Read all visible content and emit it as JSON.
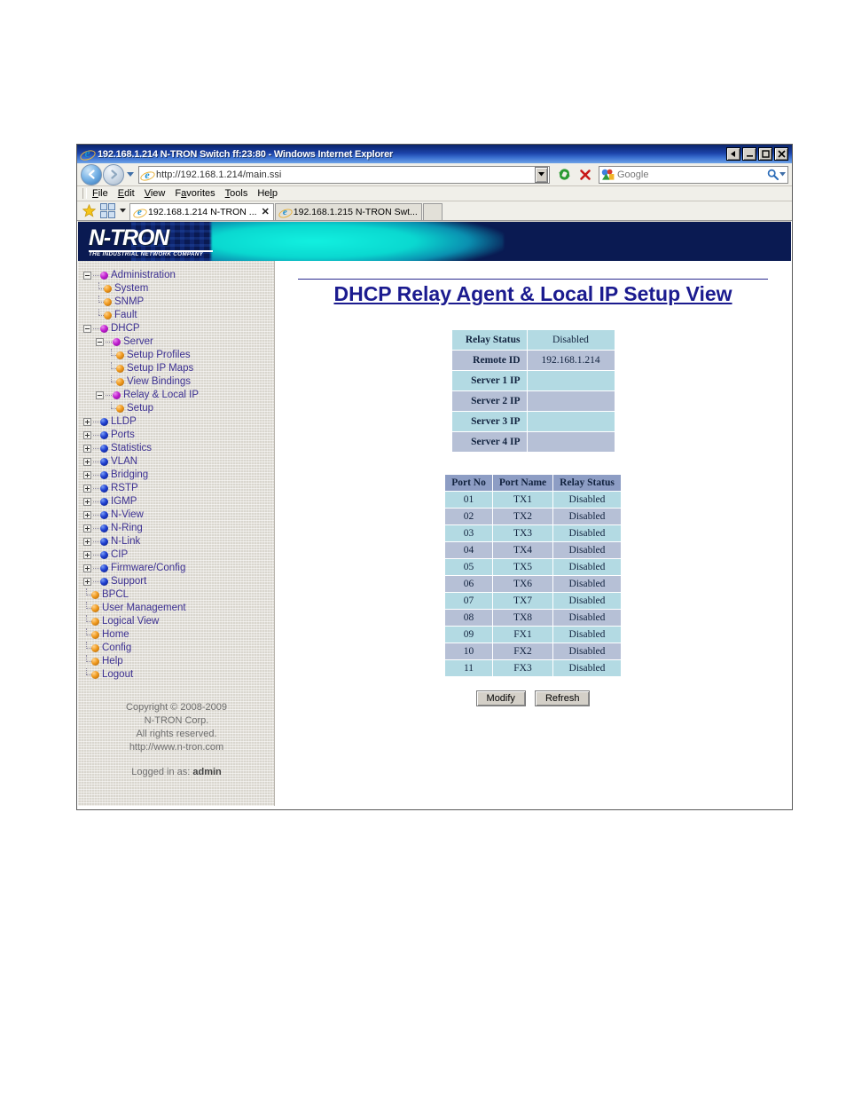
{
  "window": {
    "title": "192.168.1.214 N-TRON Switch ff:23:80 - Windows Internet Explorer",
    "buttons": {
      "restore_left": "◀",
      "minimize": "_",
      "maximize": "□",
      "close": "✕"
    }
  },
  "address_bar": {
    "url": "http://192.168.1.214/main.ssi",
    "back_icon": "back-arrow-icon",
    "forward_icon": "forward-arrow-icon",
    "history_caret": "▼",
    "refresh_icon": "refresh-icon",
    "stop_icon": "stop-icon",
    "search_placeholder": "Google",
    "search_icon": "magnifier-icon"
  },
  "menu": {
    "items": [
      "File",
      "Edit",
      "View",
      "Favorites",
      "Tools",
      "Help"
    ]
  },
  "tabs": {
    "favorites_icon": "star-icon",
    "quicktabs_icon": "quick-tabs-icon",
    "list_caret": "▼",
    "items": [
      {
        "label": "192.168.1.214 N-TRON ...",
        "active": true,
        "close": "✕"
      },
      {
        "label": "192.168.1.215 N-TRON Swt...",
        "active": false,
        "close": ""
      }
    ]
  },
  "banner": {
    "logo_text": "N-TRON",
    "tagline": "THE INDUSTRIAL NETWORK COMPANY"
  },
  "sidebar": {
    "tree": [
      {
        "label": "Administration",
        "level": 1,
        "toggle": "minus",
        "bullet": "magenta"
      },
      {
        "label": "System",
        "level": 2,
        "toggle": "none",
        "bullet": "orange"
      },
      {
        "label": "SNMP",
        "level": 2,
        "toggle": "none",
        "bullet": "orange"
      },
      {
        "label": "Fault",
        "level": 2,
        "toggle": "none",
        "bullet": "orange",
        "last": true
      },
      {
        "label": "DHCP",
        "level": 1,
        "toggle": "minus",
        "bullet": "magenta"
      },
      {
        "label": "Server",
        "level": 2,
        "toggle": "minus",
        "bullet": "magenta"
      },
      {
        "label": "Setup Profiles",
        "level": 3,
        "toggle": "none",
        "bullet": "orange"
      },
      {
        "label": "Setup IP Maps",
        "level": 3,
        "toggle": "none",
        "bullet": "orange"
      },
      {
        "label": "View Bindings",
        "level": 3,
        "toggle": "none",
        "bullet": "orange",
        "last": true
      },
      {
        "label": "Relay & Local IP",
        "level": 2,
        "toggle": "minus",
        "bullet": "magenta"
      },
      {
        "label": "Setup",
        "level": 3,
        "toggle": "none",
        "bullet": "orange",
        "last": true
      },
      {
        "label": "LLDP",
        "level": 1,
        "toggle": "plus",
        "bullet": "blue"
      },
      {
        "label": "Ports",
        "level": 1,
        "toggle": "plus",
        "bullet": "blue"
      },
      {
        "label": "Statistics",
        "level": 1,
        "toggle": "plus",
        "bullet": "blue"
      },
      {
        "label": "VLAN",
        "level": 1,
        "toggle": "plus",
        "bullet": "blue"
      },
      {
        "label": "Bridging",
        "level": 1,
        "toggle": "plus",
        "bullet": "blue"
      },
      {
        "label": "RSTP",
        "level": 1,
        "toggle": "plus",
        "bullet": "blue"
      },
      {
        "label": "IGMP",
        "level": 1,
        "toggle": "plus",
        "bullet": "blue"
      },
      {
        "label": "N-View",
        "level": 1,
        "toggle": "plus",
        "bullet": "blue"
      },
      {
        "label": "N-Ring",
        "level": 1,
        "toggle": "plus",
        "bullet": "blue"
      },
      {
        "label": "N-Link",
        "level": 1,
        "toggle": "plus",
        "bullet": "blue"
      },
      {
        "label": "CIP",
        "level": 1,
        "toggle": "plus",
        "bullet": "blue"
      },
      {
        "label": "Firmware/Config",
        "level": 1,
        "toggle": "plus",
        "bullet": "blue"
      },
      {
        "label": "Support",
        "level": 1,
        "toggle": "plus",
        "bullet": "blue"
      },
      {
        "label": "BPCL",
        "level": 1,
        "toggle": "none",
        "bullet": "orange"
      },
      {
        "label": "User Management",
        "level": 1,
        "toggle": "none",
        "bullet": "orange"
      },
      {
        "label": "Logical View",
        "level": 1,
        "toggle": "none",
        "bullet": "orange"
      },
      {
        "label": "Home",
        "level": 1,
        "toggle": "none",
        "bullet": "orange"
      },
      {
        "label": "Config",
        "level": 1,
        "toggle": "none",
        "bullet": "orange"
      },
      {
        "label": "Help",
        "level": 1,
        "toggle": "none",
        "bullet": "orange"
      },
      {
        "label": "Logout",
        "level": 1,
        "toggle": "none",
        "bullet": "orange",
        "last": true
      }
    ],
    "copyright": [
      "Copyright © 2008-2009",
      "N-TRON Corp.",
      "All rights reserved.",
      "http://www.n-tron.com"
    ],
    "logged_in_prefix": "Logged in as:",
    "logged_in_user": "admin"
  },
  "main": {
    "title": "DHCP Relay Agent & Local IP Setup View",
    "status_table": {
      "rows": [
        {
          "label": "Relay Status",
          "value": "Disabled"
        },
        {
          "label": "Remote ID",
          "value": "192.168.1.214"
        },
        {
          "label": "Server 1 IP",
          "value": ""
        },
        {
          "label": "Server 2 IP",
          "value": ""
        },
        {
          "label": "Server 3 IP",
          "value": ""
        },
        {
          "label": "Server 4 IP",
          "value": ""
        }
      ]
    },
    "ports_table": {
      "headers": [
        "Port No",
        "Port Name",
        "Relay Status"
      ],
      "rows": [
        [
          "01",
          "TX1",
          "Disabled"
        ],
        [
          "02",
          "TX2",
          "Disabled"
        ],
        [
          "03",
          "TX3",
          "Disabled"
        ],
        [
          "04",
          "TX4",
          "Disabled"
        ],
        [
          "05",
          "TX5",
          "Disabled"
        ],
        [
          "06",
          "TX6",
          "Disabled"
        ],
        [
          "07",
          "TX7",
          "Disabled"
        ],
        [
          "08",
          "TX8",
          "Disabled"
        ],
        [
          "09",
          "FX1",
          "Disabled"
        ],
        [
          "10",
          "FX2",
          "Disabled"
        ],
        [
          "11",
          "FX3",
          "Disabled"
        ]
      ]
    },
    "buttons": {
      "modify": "Modify",
      "refresh": "Refresh"
    }
  },
  "colors": {
    "title_blue": "#1b1b8f",
    "tree_text": "#3d3192",
    "row_light": "#b3dae3",
    "row_dark": "#b6c0d6",
    "header_row": "#8d9dc4",
    "banner_navy": "#0a1a52",
    "banner_cyan": "#0ad8d0"
  }
}
